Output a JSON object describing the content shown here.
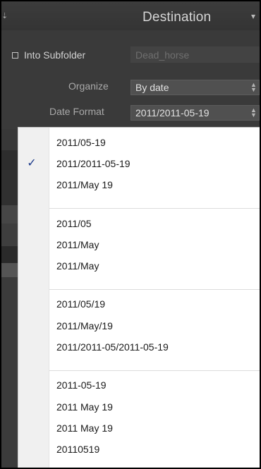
{
  "header": {
    "title": "Destination",
    "left_glyph": "⇣",
    "collapse_glyph": "▾"
  },
  "subfolder": {
    "label": "Into Subfolder",
    "checked": false,
    "placeholder": "Dead_horse"
  },
  "organize": {
    "label": "Organize",
    "value": "By date"
  },
  "date_format": {
    "label": "Date Format",
    "value": "2011/2011-05-19"
  },
  "menu": {
    "check_glyph": "✓",
    "groups": [
      [
        {
          "label": "2011/05-19",
          "checked": false
        },
        {
          "label": "2011/2011-05-19",
          "checked": true
        },
        {
          "label": "2011/May 19",
          "checked": false
        }
      ],
      [
        {
          "label": "2011/05",
          "checked": false
        },
        {
          "label": "2011/May",
          "checked": false
        },
        {
          "label": "2011/May",
          "checked": false
        }
      ],
      [
        {
          "label": "2011/05/19",
          "checked": false
        },
        {
          "label": "2011/May/19",
          "checked": false
        },
        {
          "label": "2011/2011-05/2011-05-19",
          "checked": false
        }
      ],
      [
        {
          "label": "2011-05-19",
          "checked": false
        },
        {
          "label": "2011 May 19",
          "checked": false
        },
        {
          "label": "2011 May 19",
          "checked": false
        },
        {
          "label": "20110519",
          "checked": false
        }
      ]
    ]
  },
  "colors": {
    "panel_bg": "#3a3a3a",
    "menu_bg": "#ffffff",
    "check_color": "#1c3a8a"
  }
}
